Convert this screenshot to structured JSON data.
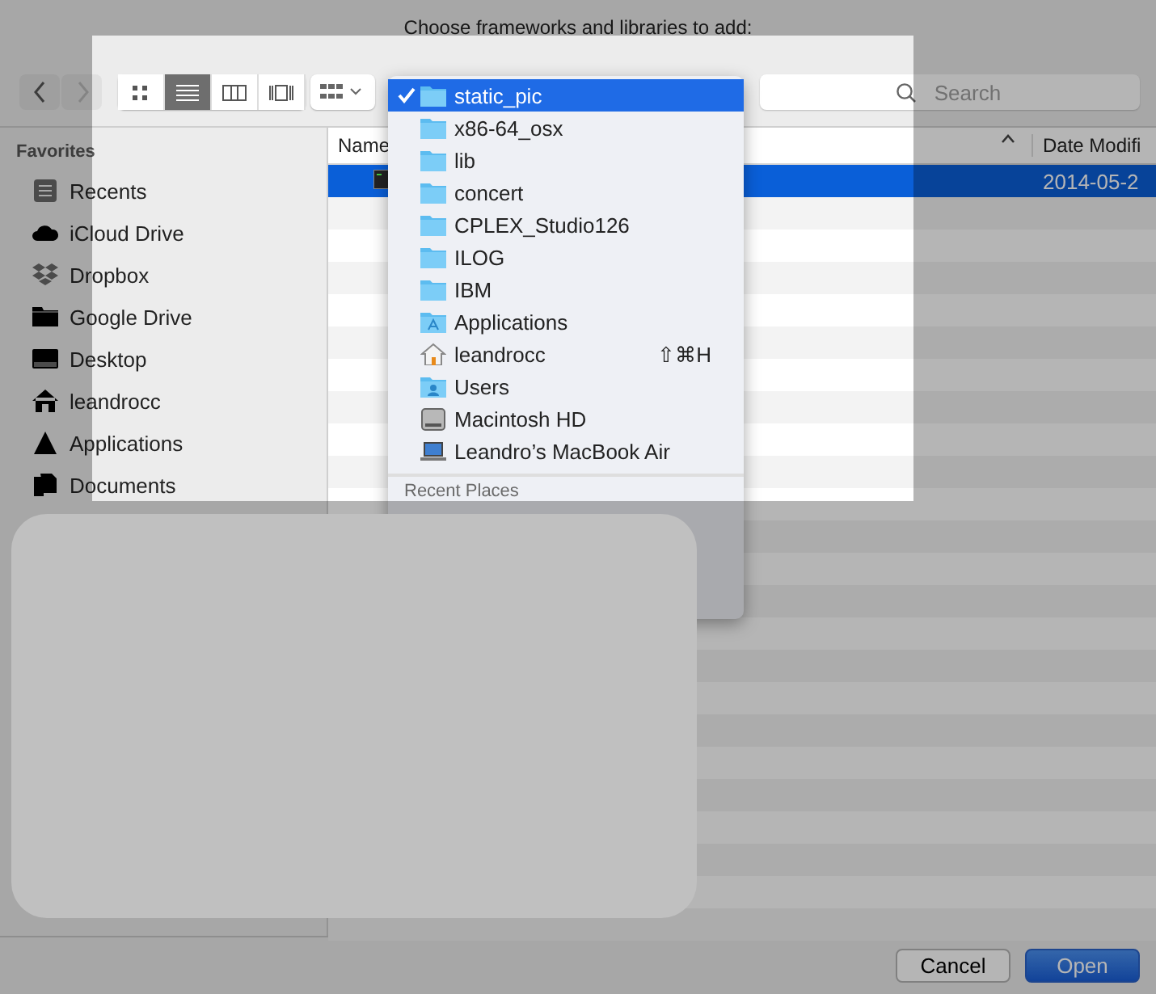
{
  "window": {
    "title": "Choose frameworks and libraries to add:"
  },
  "toolbar": {
    "nav": [
      {
        "kind": "back",
        "disabled": false
      },
      {
        "kind": "forward",
        "disabled": true
      }
    ],
    "view_modes": [
      {
        "kind": "icons",
        "selected": false
      },
      {
        "kind": "list",
        "selected": true
      },
      {
        "kind": "columns",
        "selected": false
      },
      {
        "kind": "coverflow",
        "selected": false
      }
    ],
    "search": {
      "placeholder": "Search"
    }
  },
  "path_menu": {
    "items": [
      {
        "kind": "folder",
        "label": "static_pic",
        "selected": true
      },
      {
        "kind": "folder",
        "label": "x86-64_osx",
        "selected": false
      },
      {
        "kind": "folder",
        "label": "lib",
        "selected": false
      },
      {
        "kind": "folder",
        "label": "concert",
        "selected": false
      },
      {
        "kind": "folder",
        "label": "CPLEX_Studio126",
        "selected": false
      },
      {
        "kind": "folder",
        "label": "ILOG",
        "selected": false
      },
      {
        "kind": "folder",
        "label": "IBM",
        "selected": false
      },
      {
        "kind": "apps",
        "label": "Applications",
        "selected": false
      },
      {
        "kind": "home",
        "label": "leandrocc",
        "shortcut": "⇧⌘H",
        "selected": false
      },
      {
        "kind": "users",
        "label": "Users",
        "selected": false
      },
      {
        "kind": "disk",
        "label": "Macintosh HD",
        "selected": false
      },
      {
        "kind": "laptop",
        "label": "Leandro’s MacBook Air",
        "selected": false
      }
    ],
    "section": "Recent Places"
  },
  "sidebar": {
    "heading": "Favorites",
    "items": [
      {
        "kind": "recents",
        "label": "Recents"
      },
      {
        "kind": "cloud",
        "label": "iCloud Drive"
      },
      {
        "kind": "dropbox",
        "label": "Dropbox"
      },
      {
        "kind": "folder",
        "label": "Google Drive"
      },
      {
        "kind": "desktop",
        "label": "Desktop"
      },
      {
        "kind": "home",
        "label": "leandrocc"
      },
      {
        "kind": "apps",
        "label": "Applications"
      },
      {
        "kind": "documents",
        "label": "Documents"
      }
    ]
  },
  "table": {
    "columns": [
      "Name",
      "Date Modifi"
    ],
    "rows": [
      {
        "selected": true,
        "date": "2014-05-2"
      }
    ]
  },
  "buttons": [
    {
      "kind": "cancel",
      "label": "Cancel"
    },
    {
      "kind": "default",
      "label": "Open"
    }
  ]
}
